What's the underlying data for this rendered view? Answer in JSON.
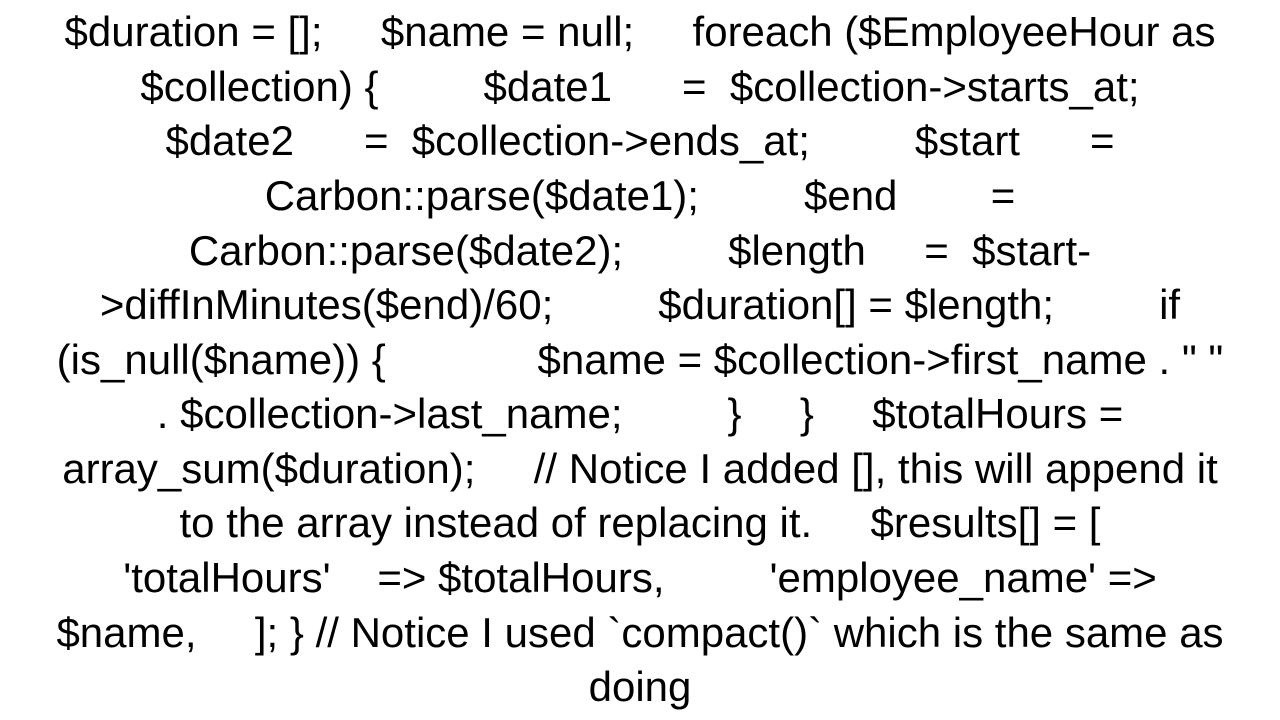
{
  "code_text": "$duration = [];     $name = null;     foreach ($EmployeeHour as $collection) {         $date1      =  $collection->starts_at;         $date2      =  $collection->ends_at;         $start      =  Carbon::parse($date1);         $end        =  Carbon::parse($date2);         $length     =  $start->diffInMinutes($end)/60;         $duration[] = $length;         if (is_null($name)) {             $name = $collection->first_name . \" \" . $collection->last_name;         }     }     $totalHours = array_sum($duration);     // Notice I added [], this will append it to the array instead of replacing it.     $results[] = [         'totalHours'    => $totalHours,         'employee_name' => $name,     ]; } // Notice I used `compact()` which is the same as doing"
}
